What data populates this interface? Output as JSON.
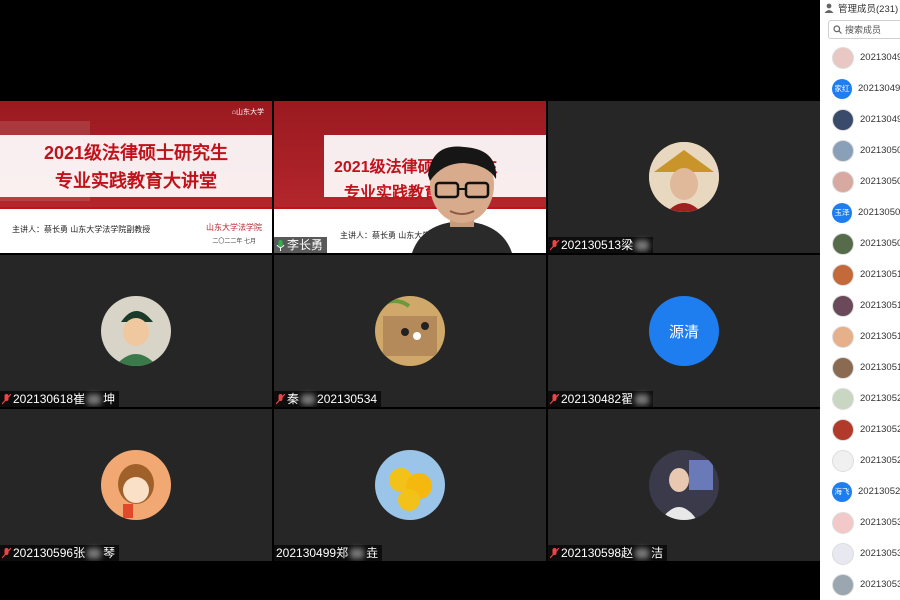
{
  "panel": {
    "title": "管理成员(231)",
    "search_placeholder": "搜索成员",
    "members": [
      {
        "name": "20213049",
        "avatar_text": "",
        "color": "#e9c7c2"
      },
      {
        "name": "20213049",
        "avatar_text": "家红",
        "color": "#1e7ef0"
      },
      {
        "name": "20213049",
        "avatar_text": "",
        "color": "#3a4a6a"
      },
      {
        "name": "20213050",
        "avatar_text": "",
        "color": "#8aa0b8"
      },
      {
        "name": "20213050",
        "avatar_text": "",
        "color": "#d8a9a0"
      },
      {
        "name": "20213050",
        "avatar_text": "玉泽",
        "color": "#1e7ef0"
      },
      {
        "name": "20213050",
        "avatar_text": "",
        "color": "#556b4a"
      },
      {
        "name": "20213051",
        "avatar_text": "",
        "color": "#c46a3a"
      },
      {
        "name": "20213051",
        "avatar_text": "",
        "color": "#6a4a5a"
      },
      {
        "name": "20213051",
        "avatar_text": "",
        "color": "#e6b08a"
      },
      {
        "name": "20213051",
        "avatar_text": "",
        "color": "#8a6a50"
      },
      {
        "name": "20213052",
        "avatar_text": "",
        "color": "#c9d6c2"
      },
      {
        "name": "20213052",
        "avatar_text": "",
        "color": "#b23a2a"
      },
      {
        "name": "20213052",
        "avatar_text": "",
        "color": "#f0f0f0"
      },
      {
        "name": "20213052",
        "avatar_text": "海飞",
        "color": "#1e7ef0"
      },
      {
        "name": "20213053",
        "avatar_text": "",
        "color": "#f2c8c8"
      },
      {
        "name": "20213053",
        "avatar_text": "",
        "color": "#e8e8f0"
      },
      {
        "name": "20213053",
        "avatar_text": "",
        "color": "#9aa6b0"
      }
    ]
  },
  "slide": {
    "title_line1": "2021级法律硕士研究生",
    "title_line2": "专业实践教育大讲堂",
    "speaker": "主讲人：蔡长勇 山东大学法学院副教授",
    "school_logo": "山东大学法学院",
    "date": "二〇二二年 七月"
  },
  "tiles": [
    {
      "id": "slide-share",
      "name": "",
      "avatar_text": ""
    },
    {
      "id": "lecturer",
      "name": "李长勇",
      "avatar_text": ""
    },
    {
      "id": "p-0513",
      "name": "202130513梁",
      "avatar_text": "",
      "avatar_color": "#caa07a"
    },
    {
      "id": "p-0618",
      "name": "202130618崔",
      "suffix": "坤",
      "avatar_text": "",
      "avatar_color": "#d9d4c8"
    },
    {
      "id": "p-0534",
      "name": "秦",
      "suffix": "202130534",
      "avatar_text": "",
      "avatar_color": "#b58a5a"
    },
    {
      "id": "p-0482",
      "name": "202130482翟",
      "avatar_text": "源清",
      "avatar_color": "#1e7ef0"
    },
    {
      "id": "p-0596",
      "name": "202130596张",
      "suffix": "琴",
      "avatar_text": "",
      "avatar_color": "#f2a872"
    },
    {
      "id": "p-0499",
      "name": "202130499郑",
      "suffix": "垚",
      "avatar_text": "",
      "avatar_color": "#f2c21a"
    },
    {
      "id": "p-0598",
      "name": "202130598赵",
      "suffix": "洁",
      "avatar_text": "",
      "avatar_color": "#4a4a5a"
    }
  ]
}
